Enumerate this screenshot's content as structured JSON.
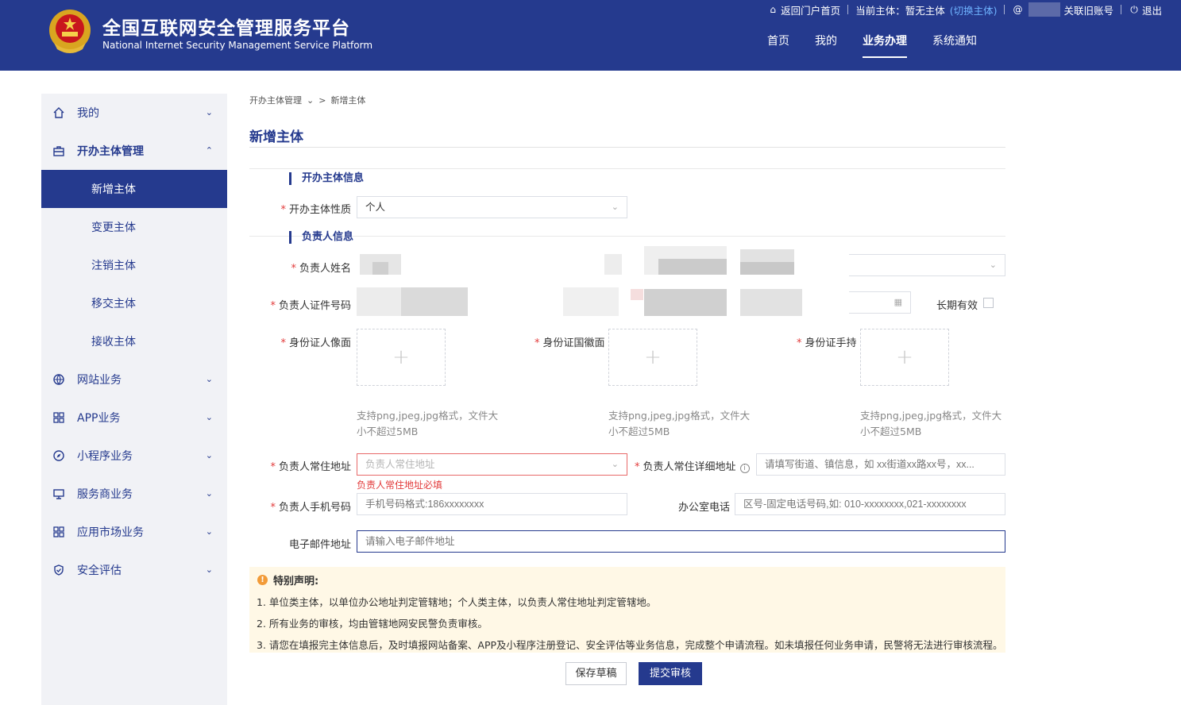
{
  "header": {
    "title_zh": "全国互联网安全管理服务平台",
    "title_en": "National Internet Security Management Service Platform",
    "topbar": {
      "portal_home": "返回门户首页",
      "current_subject_label": "当前主体：暂无主体",
      "switch_subject": "(切换主体)",
      "link_old_account": "关联旧账号",
      "logout": "退出"
    },
    "nav": [
      "首页",
      "我的",
      "业务办理",
      "系统通知"
    ],
    "nav_active": "业务办理"
  },
  "sidebar": {
    "items": [
      {
        "label": "我的",
        "icon": "home-icon"
      },
      {
        "label": "开办主体管理",
        "icon": "briefcase-icon"
      },
      {
        "label": "网站业务",
        "icon": "globe-icon"
      },
      {
        "label": "APP业务",
        "icon": "apps-grid-icon"
      },
      {
        "label": "小程序业务",
        "icon": "compass-icon"
      },
      {
        "label": "服务商业务",
        "icon": "monitor-icon"
      },
      {
        "label": "应用市场业务",
        "icon": "apps-grid-icon"
      },
      {
        "label": "安全评估",
        "icon": "shield-icon"
      }
    ],
    "sub_items": [
      "新增主体",
      "变更主体",
      "注销主体",
      "移交主体",
      "接收主体"
    ],
    "active_sub": "新增主体"
  },
  "breadcrumb": {
    "parent": "开办主体管理",
    "current": "新增主体"
  },
  "page_title": "新增主体",
  "form": {
    "section1": "开办主体信息",
    "subject_type_label": "开办主体性质",
    "subject_type_value": "个人",
    "section2": "负责人信息",
    "name_label": "负责人姓名",
    "id_number_label": "负责人证件号码",
    "long_term_label": "长期有效",
    "id_front_label": "身份证人像面",
    "id_back_label": "身份证国徽面",
    "id_hand_label": "身份证手持",
    "upload_hint": "支持png,jpeg,jpg格式，文件大小不超过5MB",
    "upload_hint_line1": "支持png,jpeg,jpg格式，文件大",
    "upload_hint_line2": "小不超过5MB",
    "address_label": "负责人常住地址",
    "address_placeholder": "负责人常住地址",
    "address_error": "负责人常住地址必填",
    "address_detail_label": "负责人常住详细地址",
    "address_detail_placeholder": "请填写街道、镇信息，如 xx街道xx路xx号，xx...",
    "phone_label": "负责人手机号码",
    "phone_placeholder": "手机号码格式:186xxxxxxxx",
    "office_phone_label": "办公室电话",
    "office_phone_placeholder": "区号-固定电话号码,如: 010-xxxxxxxx,021-xxxxxxxx",
    "email_label": "电子邮件地址",
    "email_placeholder": "请输入电子邮件地址"
  },
  "notice": {
    "title": "特别声明:",
    "lines": [
      "1. 单位类主体，以单位办公地址判定管辖地；个人类主体，以负责人常住地址判定管辖地。",
      "2. 所有业务的审核，均由管辖地网安民警负责审核。",
      "3. 请您在填报完主体信息后，及时填报网站备案、APP及小程序注册登记、安全评估等业务信息，完成整个申请流程。如未填报任何业务申请，民警将无法进行审核流程。"
    ]
  },
  "buttons": {
    "save_draft": "保存草稿",
    "submit": "提交审核"
  },
  "colors": {
    "brand": "#253a8e",
    "required": "#e23b3b",
    "notice_bg": "#fff8e6",
    "link": "#6fb3ff"
  }
}
